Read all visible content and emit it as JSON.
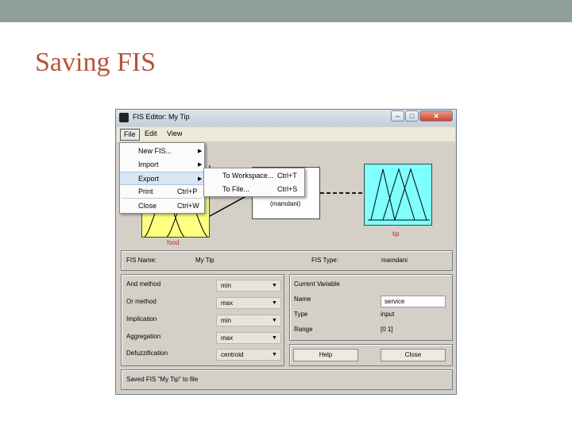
{
  "slide": {
    "title": "Saving FIS"
  },
  "window": {
    "title": "FIS Editor: My Tip",
    "buttons": {
      "minimize": "–",
      "maximize": "□",
      "close": "✕"
    }
  },
  "menubar": {
    "file": "File",
    "edit": "Edit",
    "view": "View"
  },
  "file_menu": {
    "items": [
      {
        "label": "New FIS...",
        "shortcut": "",
        "has_submenu": true
      },
      {
        "label": "Import",
        "shortcut": "",
        "has_submenu": true
      },
      {
        "label": "Export",
        "shortcut": "",
        "has_submenu": true
      },
      {
        "label": "Print",
        "shortcut": "Ctrl+P",
        "has_submenu": false
      },
      {
        "label": "Close",
        "shortcut": "Ctrl+W",
        "has_submenu": false
      }
    ]
  },
  "export_submenu": {
    "items": [
      {
        "label": "To Workspace...",
        "shortcut": "Ctrl+T"
      },
      {
        "label": "To File...",
        "shortcut": "Ctrl+S"
      }
    ]
  },
  "diagram": {
    "input_label": "food",
    "system_type_label": "(mamdani)",
    "output_label": "tip",
    "colors": {
      "input_fill": "#ffff80",
      "output_fill": "#80ffff",
      "label_color": "#c03020"
    }
  },
  "fis_info": {
    "name_label": "FIS Name:",
    "name_value": "My Tip",
    "type_label": "FIS Type:",
    "type_value": "mamdani"
  },
  "methods": {
    "and_label": "And method",
    "and_value": "min",
    "or_label": "Or method",
    "or_value": "max",
    "implication_label": "Implication",
    "implication_value": "min",
    "aggregation_label": "Aggregation",
    "aggregation_value": "max",
    "defuzz_label": "Defuzzification",
    "defuzz_value": "centroid"
  },
  "current_variable": {
    "header": "Current Variable",
    "name_label": "Name",
    "name_value": "service",
    "type_label": "Type",
    "type_value": "input",
    "range_label": "Range",
    "range_value": "[0 1]"
  },
  "buttons": {
    "help": "Help",
    "close": "Close"
  },
  "status": {
    "message": "Saved FIS \"My Tip\" to file"
  }
}
